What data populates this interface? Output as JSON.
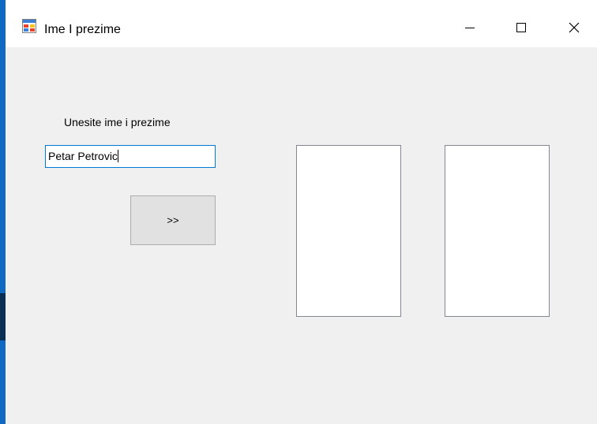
{
  "window": {
    "title": "Ime I prezime",
    "icons": {
      "app": "app-form-icon",
      "minimize": "minimize-icon",
      "maximize": "maximize-icon",
      "close": "close-icon"
    }
  },
  "form": {
    "prompt_label": "Unesite ime i prezime",
    "name_input": {
      "value": "Petar Petrovic",
      "placeholder": ""
    },
    "transfer_button_label": ">>",
    "listboxes": [
      {
        "items": []
      },
      {
        "items": []
      }
    ]
  },
  "colors": {
    "accent": "#0078d7",
    "window_edge": "#0f69c2",
    "client_background": "#f0f0f0",
    "button_face": "#e1e1e1"
  }
}
